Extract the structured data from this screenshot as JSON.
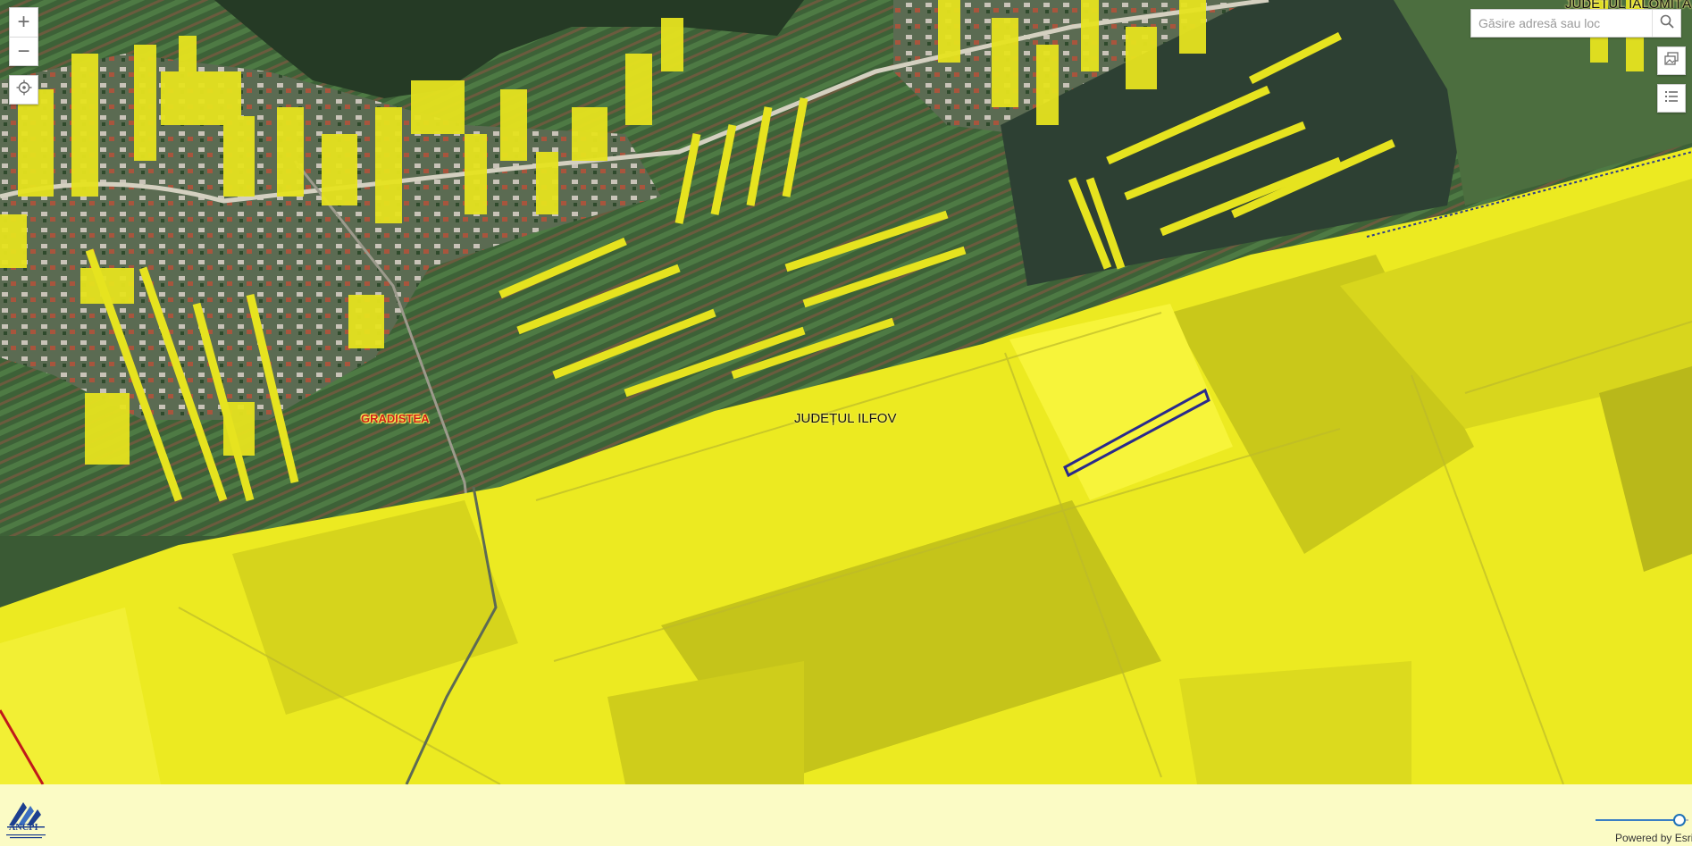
{
  "map": {
    "labels": {
      "village": "GRADISTEA",
      "county": "JUDEȚUL ILFOV",
      "county_ne": "JUDEȚUL IALOMIȚA"
    },
    "colors": {
      "parcel_yellow": "#e6e31f",
      "farmland_overlay": "#f1ef25",
      "selected_parcel_outline": "#2a2a8c",
      "county_label_village": "#d0201a"
    }
  },
  "controls": {
    "zoom_in": "+",
    "zoom_out": "−",
    "icons": {
      "locate": "locate-icon",
      "search": "search-icon",
      "basemap": "basemap-gallery-icon",
      "legend": "legend-list-icon"
    }
  },
  "search": {
    "placeholder": "Găsire adresă sau loc"
  },
  "footer": {
    "logo_text": "ANCPI",
    "powered_by": "Powered by Esri",
    "opacity_slider_value": 0.9
  }
}
